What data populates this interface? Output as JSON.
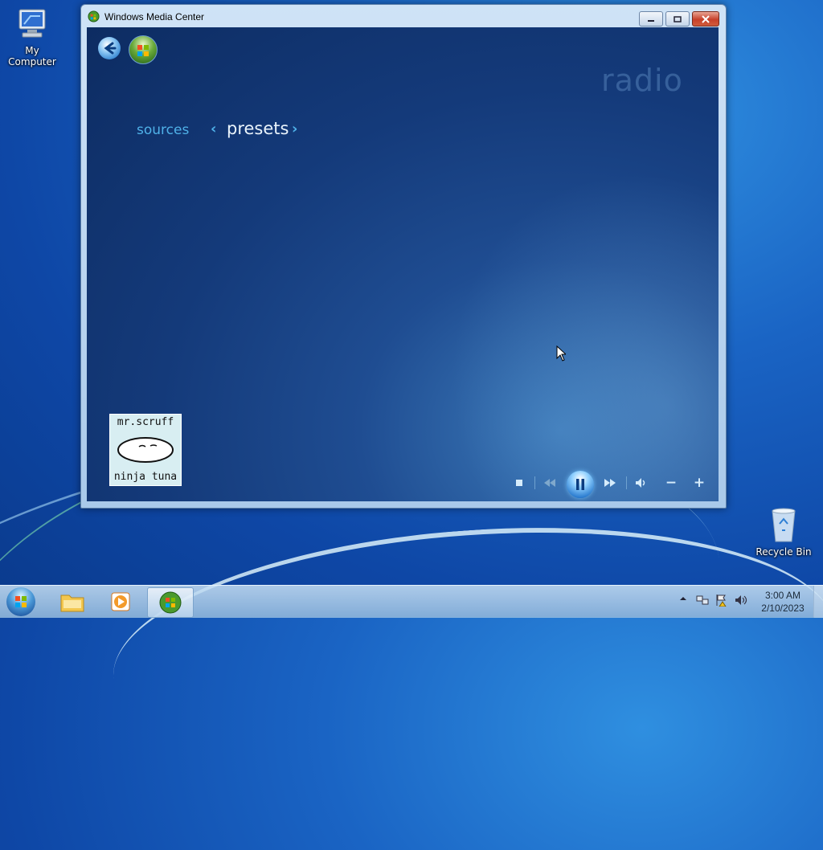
{
  "desktop": {
    "icons": [
      {
        "label": "My Computer"
      },
      {
        "label": "Recycle Bin"
      }
    ]
  },
  "window": {
    "title": "Windows Media Center",
    "section_title": "radio",
    "nav": {
      "left_label": "sources",
      "current_label": "presets"
    },
    "album_art": {
      "top_text": "mr.scruff",
      "bottom_text": "ninja tuna"
    },
    "transport": {
      "stop": "stop-icon",
      "rewind": "rewind-icon",
      "pause": "pause-icon",
      "fast_forward": "fast-forward-icon",
      "mute": "volume-icon",
      "volume_down": "−",
      "volume_up": "+"
    }
  },
  "taskbar": {
    "clock_time": "3:00 AM",
    "clock_date": "2/10/2023"
  },
  "colors": {
    "accent": "#4fb1e8",
    "client_bg": "#143a7a"
  }
}
